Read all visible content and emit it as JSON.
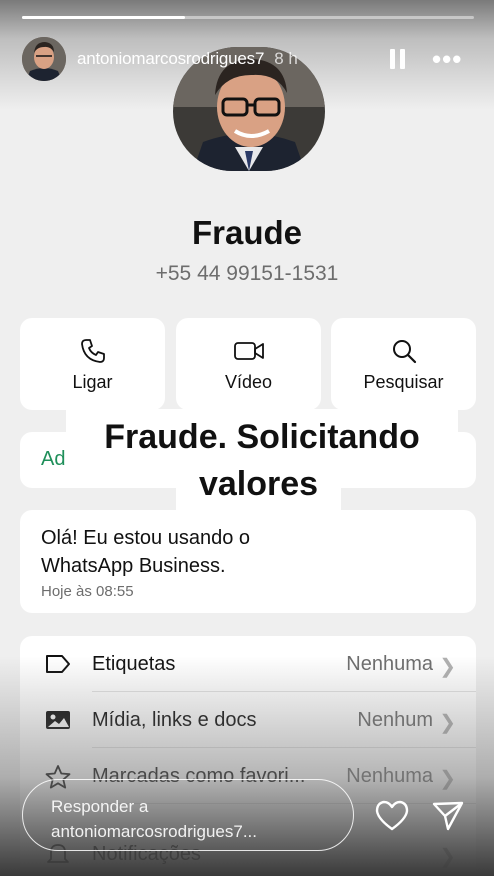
{
  "story": {
    "username": "antoniomarcosrodrigues7",
    "time_ago": "8 h",
    "progress": 0.36,
    "icons": {
      "pause": "pause-icon",
      "more": "more-icon",
      "heart": "heart-icon",
      "send": "send-icon"
    }
  },
  "contact": {
    "name": "Fraude",
    "phone": "+55 44 99151-1531"
  },
  "actions": [
    {
      "label": "Ligar",
      "icon": "phone-icon"
    },
    {
      "label": "Vídeo",
      "icon": "video-icon"
    },
    {
      "label": "Pesquisar",
      "icon": "search-icon"
    }
  ],
  "add_card": {
    "label": "Ad"
  },
  "overlay": {
    "line1": "Fraude. Solicitando",
    "line2": "valores"
  },
  "about": {
    "text": "Olá! Eu estou usando o WhatsApp Business.",
    "time": "Hoje às 08:55"
  },
  "settings": [
    {
      "label": "Etiquetas",
      "value": "Nenhuma",
      "icon": "tag-icon"
    },
    {
      "label": "Mídia, links e docs",
      "value": "Nenhum",
      "icon": "image-icon"
    },
    {
      "label": "Marcadas como favori...",
      "value": "Nenhuma",
      "icon": "star-icon"
    },
    {
      "label": "Notificações",
      "value": "",
      "icon": "bell-icon"
    }
  ],
  "reply": {
    "placeholder": "Responder a antoniomarcosrodrigues7..."
  },
  "colors": {
    "accent_green": "#1f8f5a",
    "card_bg": "#ffffff",
    "page_bg": "#efefef"
  }
}
